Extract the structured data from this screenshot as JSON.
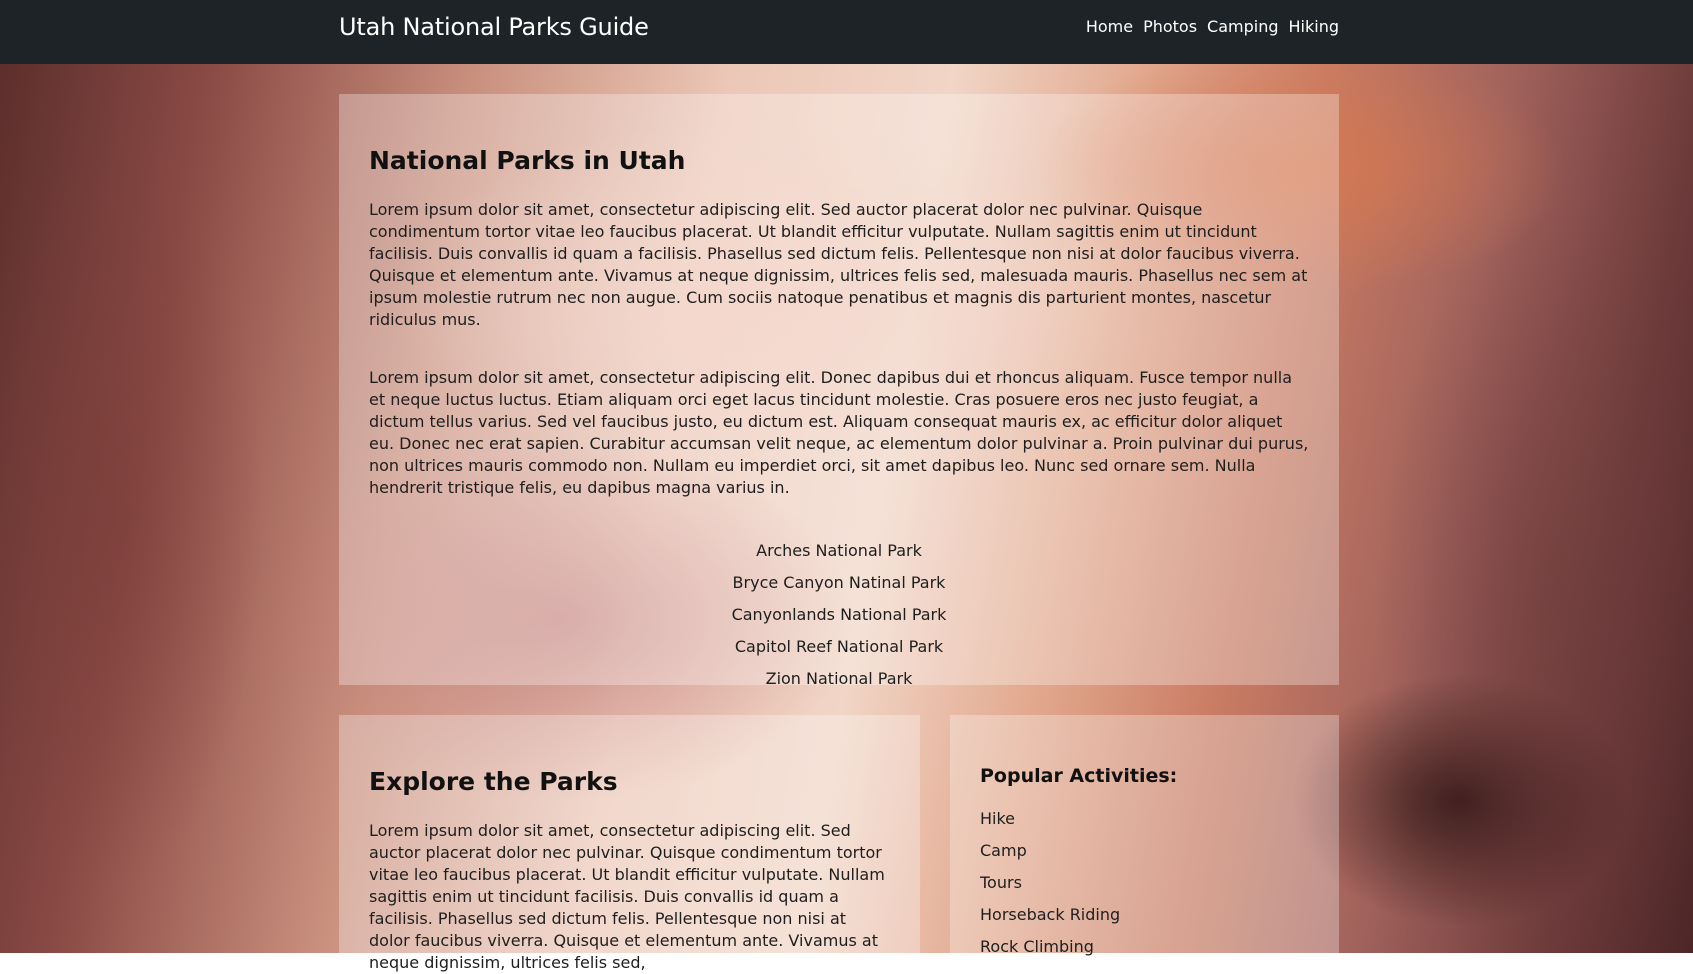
{
  "navbar": {
    "brand": "Utah National Parks Guide",
    "links": [
      "Home",
      "Photos",
      "Camping",
      "Hiking"
    ]
  },
  "main": {
    "title": "National Parks in Utah",
    "paragraphs": [
      "Lorem ipsum dolor sit amet, consectetur adipiscing elit. Sed auctor placerat dolor nec pulvinar. Quisque condimentum tortor vitae leo faucibus placerat. Ut blandit efficitur vulputate. Nullam sagittis enim ut tincidunt facilisis. Duis convallis id quam a facilisis. Phasellus sed dictum felis. Pellentesque non nisi at dolor faucibus viverra. Quisque et elementum ante. Vivamus at neque dignissim, ultrices felis sed, malesuada mauris. Phasellus nec sem at ipsum molestie rutrum nec non augue. Cum sociis natoque penatibus et magnis dis parturient montes, nascetur ridiculus mus.",
      "Lorem ipsum dolor sit amet, consectetur adipiscing elit. Donec dapibus dui et rhoncus aliquam. Fusce tempor nulla et neque luctus luctus. Etiam aliquam orci eget lacus tincidunt molestie. Cras posuere eros nec justo feugiat, a dictum tellus varius. Sed vel faucibus justo, eu dictum est. Aliquam consequat mauris ex, ac efficitur dolor aliquet eu. Donec nec erat sapien. Curabitur accumsan velit neque, ac elementum dolor pulvinar a. Proin pulvinar dui purus, non ultrices mauris commodo non. Nullam eu imperdiet orci, sit amet dapibus leo. Nunc sed ornare sem. Nulla hendrerit tristique felis, eu dapibus magna varius in."
    ],
    "parks": [
      "Arches National Park",
      "Bryce Canyon Natinal Park",
      "Canyonlands National Park",
      "Capitol Reef National Park",
      "Zion National Park"
    ]
  },
  "explore": {
    "title": "Explore the Parks",
    "paragraph": "Lorem ipsum dolor sit amet, consectetur adipiscing elit. Sed auctor placerat dolor nec pulvinar. Quisque condimentum tortor vitae leo faucibus placerat. Ut blandit efficitur vulputate. Nullam sagittis enim ut tincidunt facilisis. Duis convallis id quam a facilisis. Phasellus sed dictum felis. Pellentesque non nisi at dolor faucibus viverra. Quisque et elementum ante. Vivamus at neque dignissim, ultrices felis sed,"
  },
  "activities": {
    "title": "Popular Activities:",
    "items": [
      "Hike",
      "Camp",
      "Tours",
      "Horseback Riding",
      "Rock Climbing"
    ]
  }
}
